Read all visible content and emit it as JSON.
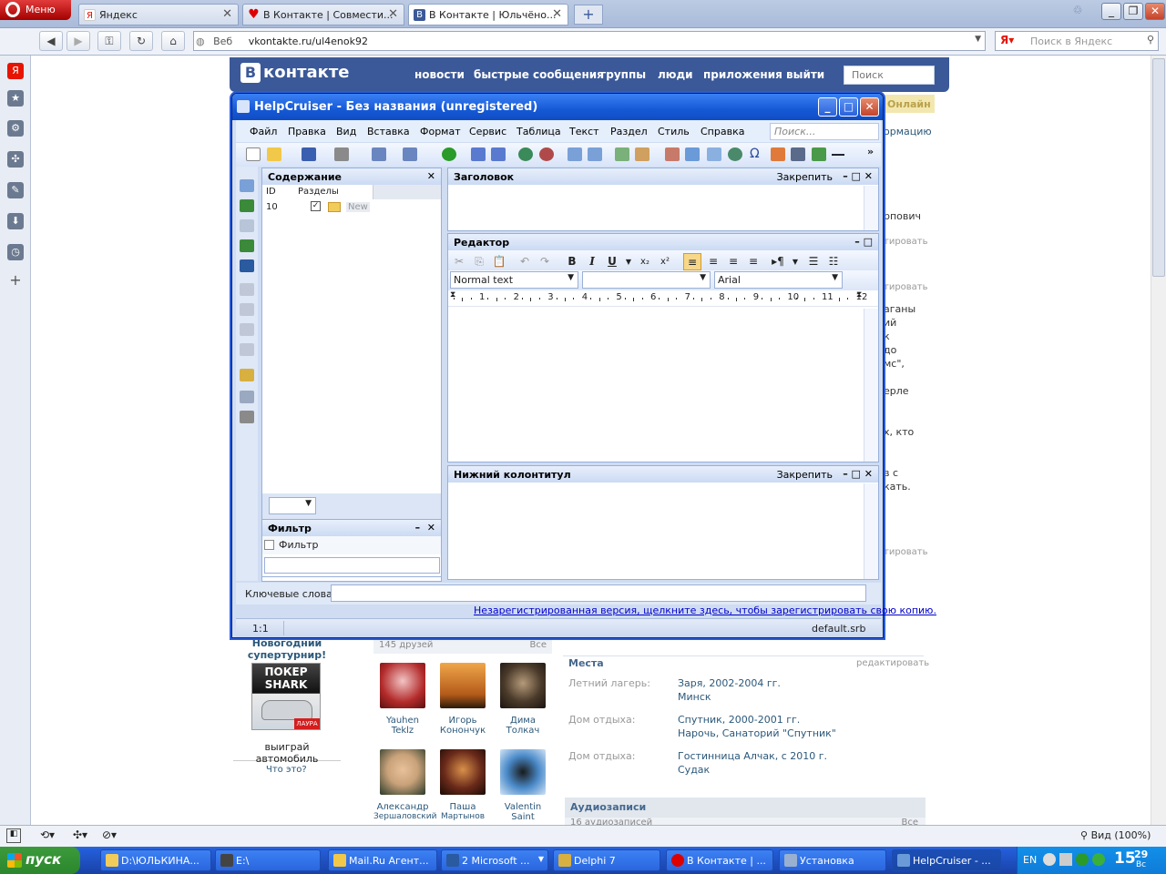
{
  "browser": {
    "menu_label": "Меню",
    "tabs": [
      {
        "label": "Яндекс"
      },
      {
        "label": "В Контакте | Совмести..."
      },
      {
        "label": "В Контакте | Юльчёно..."
      }
    ],
    "url_prefix": "Веб",
    "url": "vkontakte.ru/ul4enok92",
    "search_placeholder": "Поиск в Яндекс",
    "zoom": "Вид (100%)"
  },
  "vk": {
    "logo": "контакте",
    "nav": [
      "новости",
      "быстрые сообщения",
      "группы",
      "люди",
      "приложения",
      "выйти"
    ],
    "search_placeholder": "Поиск",
    "online": "Онлайн",
    "right_fragments": [
      "ормацию",
      "рпович",
      "тировать",
      "тировать",
      "аганы",
      "ий",
      "к",
      "до",
      "мс\",",
      "ерле",
      "х, кто",
      "в с",
      "кать.",
      "тировать"
    ],
    "ad_title": "Новогодний супертурнир!",
    "ad_caption": "выиграй автомобиль",
    "ad_brand": "ПОКЕР SHARK",
    "ad_logo": "ЛАУРА",
    "ad_help": "Что это?",
    "friends_count": "145 друзей",
    "friends_all": "Все",
    "friends": [
      {
        "first": "Yauhen",
        "last": "Teklz",
        "color": "#b32a2a"
      },
      {
        "first": "Игорь",
        "last": "Конончук",
        "color": "#d9882a"
      },
      {
        "first": "Дима",
        "last": "Толкач",
        "color": "#4a3a2a"
      },
      {
        "first": "Александр",
        "last": "Зершаловский",
        "color": "#c9a27a"
      },
      {
        "first": "Паша",
        "last": "Мартынов",
        "color": "#6a2a1a"
      },
      {
        "first": "Valentin",
        "last": "Saint",
        "color": "#4a8ac9"
      }
    ],
    "places_title": "Места",
    "places_edit": "редактировать",
    "places": [
      {
        "label": "Летний лагерь:",
        "line1": "Заря, 2002-2004 гг.",
        "line2": "Минск"
      },
      {
        "label": "Дом отдыха:",
        "line1": "Спутник, 2000-2001 гг.",
        "line2": "Нарочь, Санаторий \"Спутник\""
      },
      {
        "label": "Дом отдыха:",
        "line1": "Гостинница Алчак, с 2010 г.",
        "line2": "Судак"
      }
    ],
    "audio_title": "Аудиозаписи",
    "audio_count": "16 аудиозаписей",
    "audio_all": "Все"
  },
  "helpcruiser": {
    "title": "HelpCruiser - Без названия (unregistered)",
    "menu": [
      "Файл",
      "Правка",
      "Вид",
      "Вставка",
      "Формат",
      "Сервис",
      "Таблица",
      "Текст",
      "Раздел",
      "Стиль",
      "Справка"
    ],
    "search_placeholder": "Поиск...",
    "contents": {
      "title": "Содержание",
      "col_id": "ID",
      "col_sections": "Разделы",
      "row_id": "10",
      "row_name": "New"
    },
    "filter": {
      "title": "Фильтр",
      "checkbox_label": "Фильтр"
    },
    "header_pane": {
      "title": "Заголовок",
      "pin": "Закрепить"
    },
    "editor": {
      "title": "Редактор",
      "style": "Normal text",
      "size": "",
      "font": "Arial",
      "ruler": [
        "1",
        "2",
        "3",
        "4",
        "5",
        "6",
        "7",
        "8",
        "9",
        "10",
        "11",
        "12"
      ]
    },
    "footer_pane": {
      "title": "Нижний колонтитул",
      "pin": "Закрепить"
    },
    "keywords_label": "Ключевые слова",
    "register_link": "Незарегистрированная версия, щелкните здесь, чтобы зарегистрировать свою копию.",
    "status_pos": "1:1",
    "status_file": "default.srb"
  },
  "taskbar": {
    "start": "пуск",
    "tasks": [
      "D:\\ЮЛЬКИНА...",
      "E:\\",
      "Mail.Ru Агент...",
      "2 Microsoft ...",
      "Delphi 7",
      "В Контакте | ...",
      "Установка",
      "HelpCruiser - ..."
    ],
    "lang": "EN",
    "time_h": "15",
    "time_m": "29",
    "day": "Вс"
  }
}
